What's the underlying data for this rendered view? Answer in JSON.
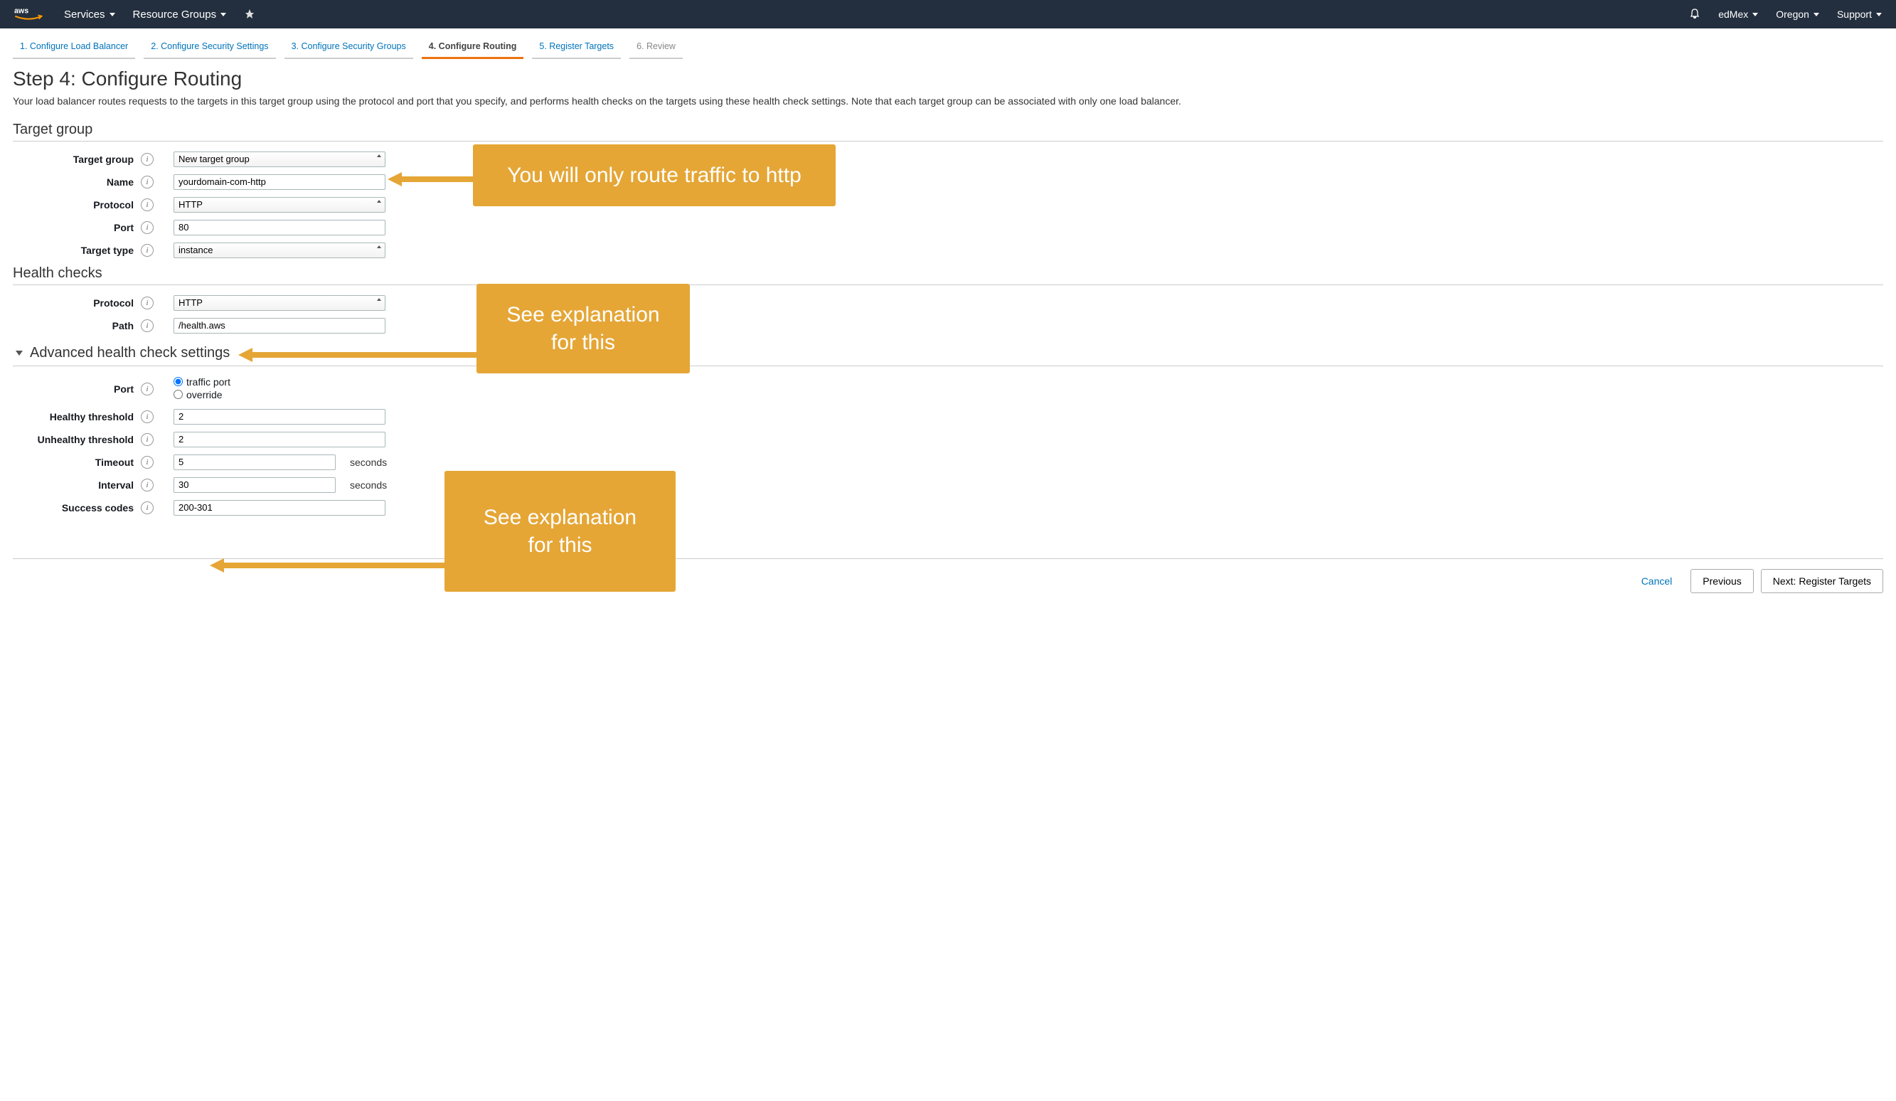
{
  "nav": {
    "services": "Services",
    "resource_groups": "Resource Groups",
    "user": "edMex",
    "region": "Oregon",
    "support": "Support"
  },
  "steps": [
    {
      "label": "1. Configure Load Balancer"
    },
    {
      "label": "2. Configure Security Settings"
    },
    {
      "label": "3. Configure Security Groups"
    },
    {
      "label": "4. Configure Routing"
    },
    {
      "label": "5. Register Targets"
    },
    {
      "label": "6. Review"
    }
  ],
  "page": {
    "title": "Step 4: Configure Routing",
    "description": "Your load balancer routes requests to the targets in this target group using the protocol and port that you specify, and performs health checks on the targets using these health check settings. Note that each target group can be associated with only one load balancer."
  },
  "sections": {
    "target_group": "Target group",
    "health_checks": "Health checks",
    "advanced": "Advanced health check settings"
  },
  "labels": {
    "target_group": "Target group",
    "name": "Name",
    "protocol": "Protocol",
    "port": "Port",
    "target_type": "Target type",
    "path": "Path",
    "healthy_threshold": "Healthy threshold",
    "unhealthy_threshold": "Unhealthy threshold",
    "timeout": "Timeout",
    "interval": "Interval",
    "success_codes": "Success codes",
    "seconds": "seconds",
    "traffic_port": "traffic port",
    "override": "override"
  },
  "values": {
    "target_group_select": "New target group",
    "name": "yourdomain-com-http",
    "protocol": "HTTP",
    "port": "80",
    "target_type": "instance",
    "hc_protocol": "HTTP",
    "hc_path": "/health.aws",
    "hc_port_mode": "traffic",
    "healthy_threshold": "2",
    "unhealthy_threshold": "2",
    "timeout": "5",
    "interval": "30",
    "success_codes": "200-301"
  },
  "callouts": {
    "c1": "You will only route traffic to http",
    "c2": "See explanation for this",
    "c3": "See explanation for this"
  },
  "footer": {
    "cancel": "Cancel",
    "previous": "Previous",
    "next": "Next: Register Targets"
  }
}
